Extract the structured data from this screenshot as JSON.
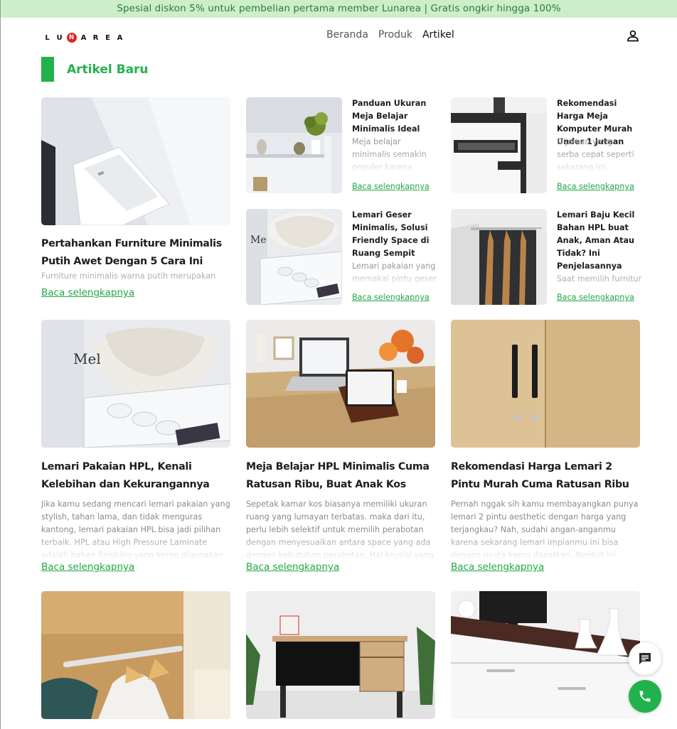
{
  "promo": "Spesial diskon 5% untuk pembelian pertama member Lunarea | Gratis ongkir hingga 100%",
  "logo": {
    "letters": [
      "L",
      "U",
      "N",
      "A",
      "R",
      "E",
      "A"
    ]
  },
  "nav": {
    "items": [
      "Beranda",
      "Produk",
      "Artikel"
    ],
    "active": "Artikel"
  },
  "section": {
    "title": "Artikel Baru"
  },
  "featured": {
    "title": "Pertahankan Furniture Minimalis Putih Awet Dengan 5 Cara Ini",
    "excerpt": "Furniture minimalis warna putih merupakan salah",
    "read_more": "Baca selengkapnya"
  },
  "small_articles": [
    {
      "title": "Panduan Ukuran Meja Belajar Minimalis Ideal",
      "excerpt": "Meja belajar minimalis semakin populer karena",
      "read_more": "Baca selengkapnya"
    },
    {
      "title": "Rekomendasi Harga Meja Komputer Murah Under 1 Jutaan",
      "excerpt": "Dijaman yang serba cepat seperti sekarang ini,",
      "read_more": "Baca selengkapnya"
    },
    {
      "title": "Lemari Geser Minimalis, Solusi Friendly Space di Ruang Sempit",
      "excerpt": "Lemari pakaian yang memakai pintu geser",
      "read_more": "Baca selengkapnya"
    },
    {
      "title": "Lemari Baju Kecil Bahan HPL buat Anak, Aman Atau Tidak? Ini Penjelasannya",
      "excerpt": "Saat memilih furnitur",
      "read_more": "Baca selengkapnya"
    }
  ],
  "grid_articles": [
    {
      "title": "Lemari Pakaian HPL, Kenali Kelebihan dan Kekurangannya",
      "excerpt": "Jika kamu sedang mencari lemari pakaian yang stylish, tahan lama, dan tidak menguras kantong, lemari pakaian HPL bisa jadi pilihan terbaik. HPL atau High Pressure Laminate adalah bahan finishing yang kerap digunakan pada berbagai",
      "read_more": "Baca selengkapnya"
    },
    {
      "title": "Meja Belajar HPL Minimalis Cuma Ratusan Ribu, Buat Anak Kos",
      "excerpt": "Sepetak kamar kos biasanya memiliki ukuran ruang yang lumayan terbatas. maka dari itu, perlu lebih selektif untuk memilih perabotan dengan menyesuaikan antara space yang ada dengan kebutuhan perabotan. Hal krusial yang kadang",
      "read_more": "Baca selengkapnya"
    },
    {
      "title": "Rekomendasi Harga Lemari 2 Pintu Murah Cuma Ratusan Ribu",
      "excerpt": "Pernah nggak sih kamu membayangkan punya lemari 2 pintu aesthetic dengan harga yang terjangkau? Nah, sudahi angan-anganmu karena sekarang lemari impianmu ini bisa dengan nyata kamu dapatkan. Berikut ini adalah rekomendasi",
      "read_more": "Baca selengkapnya"
    }
  ],
  "label_badge": "Lunarea"
}
